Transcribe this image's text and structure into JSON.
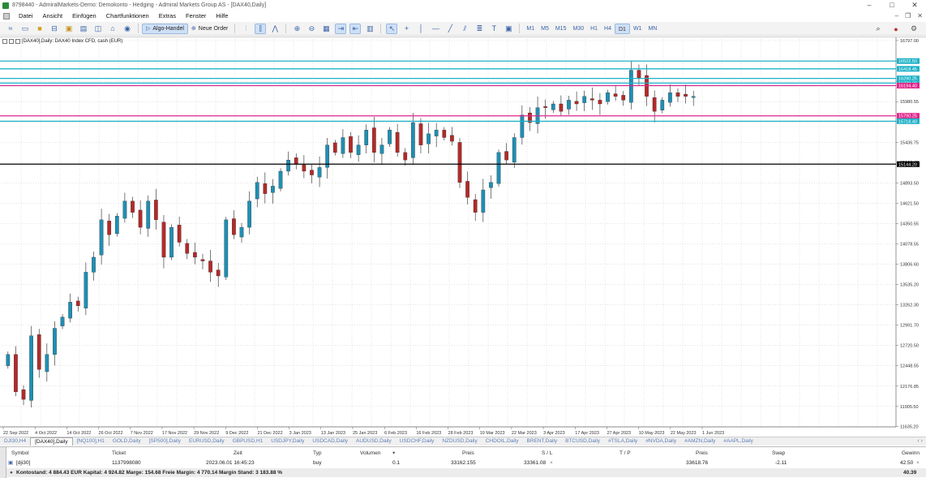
{
  "window": {
    "title": "8798440 - AdmiralMarkets-Demo: Demokonto - Hedging - Admiral Markets Group AS - [DAX40,Daily]"
  },
  "menu": [
    "Datei",
    "Ansicht",
    "Einfügen",
    "Chartfunktionen",
    "Extras",
    "Fenster",
    "Hilfe"
  ],
  "toolbar": {
    "algo_label": "Algo-Handel",
    "new_order_label": "Neue Order",
    "timeframes": [
      "M1",
      "M5",
      "M15",
      "M30",
      "H1",
      "H4",
      "D1",
      "W1",
      "MN"
    ],
    "active_timeframe": "D1"
  },
  "chart": {
    "header": "[DAX40],Daily:  DAX40 Index CFD, cash (EUR)",
    "price_levels": [
      "16797.00",
      "16522.50",
      "16250.70",
      "15980.55",
      "15708.65",
      "15436.75",
      "15166.40",
      "14893.50",
      "14621.50",
      "14350.55",
      "14078.55",
      "13806.60",
      "13535.20",
      "13262.30",
      "12991.70",
      "12720.50",
      "12448.55",
      "12176.85",
      "11905.50",
      "11635.20"
    ],
    "date_labels": [
      "22 Sep 2022",
      "4 Oct 2022",
      "14 Oct 2022",
      "26 Oct 2022",
      "7 Nov 2022",
      "17 Nov 2022",
      "29 Nov 2022",
      "9 Dec 2022",
      "21 Dec 2022",
      "3 Jan 2023",
      "13 Jan 2023",
      "25 Jan 2023",
      "6 Feb 2023",
      "16 Feb 2023",
      "28 Feb 2023",
      "10 Mar 2023",
      "22 Mar 2023",
      "3 Apr 2023",
      "17 Apr 2023",
      "27 Apr 2023",
      "10 May 2023",
      "22 May 2023",
      "1 Jun 2023"
    ],
    "hlines": [
      {
        "value": 16522.5,
        "color": "#1eb2c8",
        "label": "16522.50"
      },
      {
        "value": 16418.45,
        "color": "#1eb2c8",
        "label": "16418.45"
      },
      {
        "value": 16290.25,
        "color": "#1eb2c8",
        "label": "16290.25"
      },
      {
        "value": 16228.2,
        "color": "#1eb2c8",
        "label": "16228.20"
      },
      {
        "value": 16194.4,
        "color": "#e0248a",
        "label": "16194.40"
      },
      {
        "value": 15790.25,
        "color": "#e0248a",
        "label": "15790.25"
      },
      {
        "value": 15718.4,
        "color": "#1eb2c8",
        "label": "15718.40"
      },
      {
        "value": 15144.2,
        "color": "#000000",
        "label": "15144.20"
      }
    ],
    "up_color": "#1f8fb4",
    "down_color": "#b32a2a"
  },
  "chart_data": {
    "type": "candlestick",
    "title": "",
    "ylim": [
      11632,
      16818
    ],
    "categories": [
      "22 Sep 2022",
      "4 Oct 2022",
      "14 Oct 2022",
      "26 Oct 2022",
      "7 Nov 2022",
      "17 Nov 2022",
      "29 Nov 2022",
      "9 Dec 2022",
      "21 Dec 2022",
      "3 Jan 2023",
      "13 Jan 2023",
      "25 Jan 2023",
      "6 Feb 2023",
      "16 Feb 2023",
      "28 Feb 2023",
      "10 Mar 2023",
      "22 Mar 2023",
      "3 Apr 2023",
      "17 Apr 2023",
      "27 Apr 2023",
      "10 May 2023",
      "22 May 2023",
      "1 Jun 2023"
    ],
    "closes": [
      12600,
      12100,
      12000,
      12850,
      12400,
      12600,
      12950,
      13100,
      13300,
      13250,
      13700,
      13900,
      14400,
      14200,
      14450,
      14650,
      14500,
      14300,
      14650,
      14400,
      13900,
      14300,
      14100,
      13950,
      13900,
      13850,
      13700,
      13650,
      14400,
      14200,
      14300,
      14650,
      14900,
      14750,
      14850,
      15050,
      15200,
      15150,
      15050,
      15000,
      15100,
      15400,
      15300,
      15500,
      15300,
      15400,
      15600,
      15300,
      15400,
      15600,
      15300,
      15200,
      15700,
      15400,
      15550,
      15600,
      15500,
      15450,
      14900,
      14700,
      14500,
      14800,
      14900,
      15300,
      15200,
      15500,
      15800,
      15700,
      15900,
      15900,
      15950,
      15850,
      16000,
      15950,
      16050,
      16000,
      15950,
      16100,
      16050,
      16000,
      16400,
      16300,
      16050,
      15850,
      16000,
      16100,
      16050,
      16050,
      16050
    ],
    "series": [
      {
        "name": "DAX40",
        "values": "closes"
      }
    ]
  },
  "symbol_tabs": [
    "DJI30,H4",
    "[DAX40],Daily",
    "[NQ100],H1",
    "GOLD,Daily",
    "[SP500],Daily",
    "EURUSD,Daily",
    "GBPUSD,H1",
    "USDJPY,Daily",
    "USDCAD,Daily",
    "AUDUSD,Daily",
    "USDCHF,Daily",
    "NZDUSD,Daily",
    "CHDOIL,Daily",
    "BRENT,Daily",
    "BTCUSD,Daily",
    "#TSLA,Daily",
    "#NVDA,Daily",
    "#AMZN,Daily",
    "#AAPL,Daily"
  ],
  "active_symbol_tab": 1,
  "terminal": {
    "headers": {
      "symbol": "Symbol",
      "ticket": "Ticket",
      "time": "Zeit",
      "type": "Typ",
      "volume": "Volumen",
      "price": "Preis",
      "sl": "S / L",
      "tp": "T / P",
      "price2": "Preis",
      "swap": "Swap",
      "profit": "Gewinn"
    },
    "row": {
      "symbol": "[dji30]",
      "ticket": "1137998080",
      "time": "2023.06.01 16:45:23",
      "type": "buy",
      "volume": "0.1",
      "price": "33162.155",
      "sl": "33361.08",
      "tp": "",
      "price2": "33618.76",
      "swap": "-2.11",
      "profit": "42.50"
    },
    "footer": {
      "summary": "Kontostand: 4 884.43 EUR  Kapital: 4 924.82  Marge: 154.68  Freie Margin: 4 770.14  Margin Stand: 3 183.88 %",
      "total": "40.39"
    }
  }
}
